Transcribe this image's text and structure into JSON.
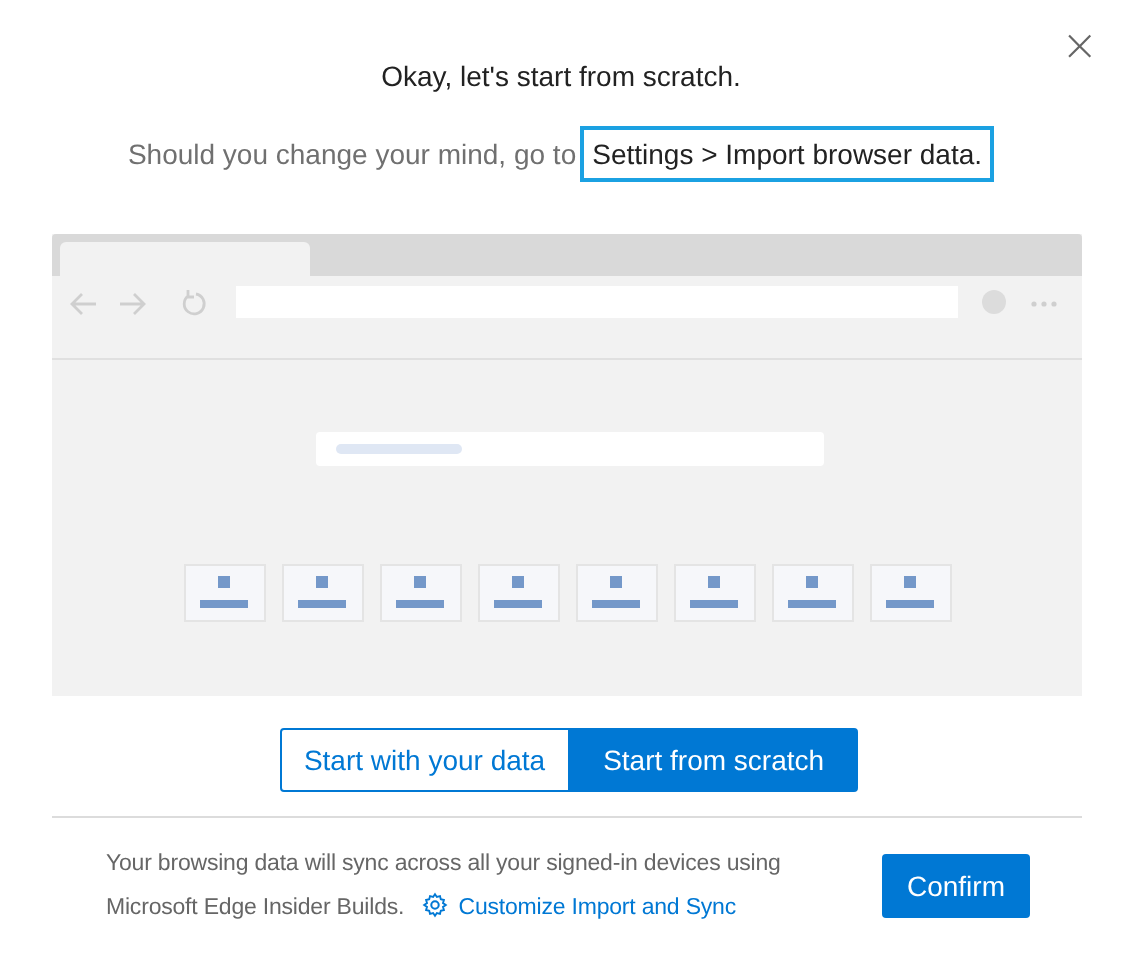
{
  "close_button": {
    "label": "×"
  },
  "title": "Okay, let's start from scratch.",
  "hint": {
    "text": "Should you change your mind, go to",
    "path": "Settings > Import browser data."
  },
  "choices": [
    {
      "label": "Start with your data",
      "selected": false
    },
    {
      "label": "Start from scratch",
      "selected": true
    }
  ],
  "footer": {
    "lines": [
      "Your browsing data will sync across all your signed-in devices using",
      "Microsoft Edge Insider Builds."
    ],
    "link": "Customize Import and Sync"
  },
  "confirm_button": "Confirm"
}
